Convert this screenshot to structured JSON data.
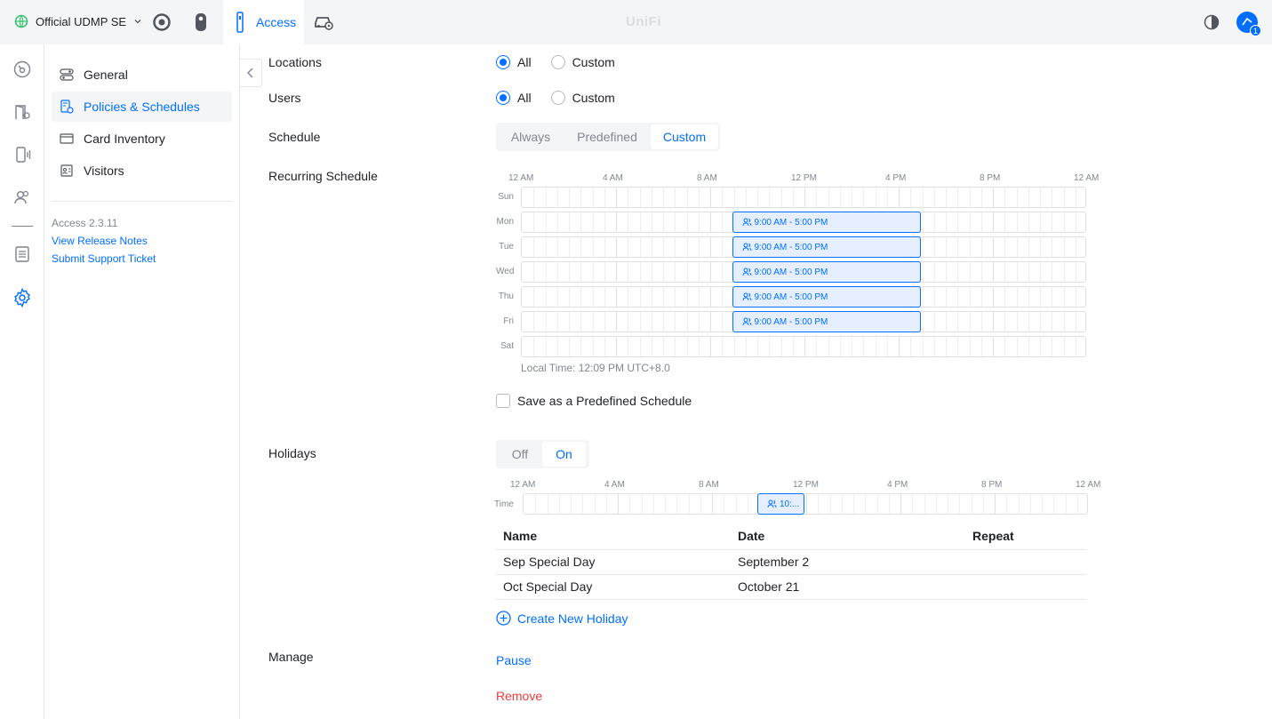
{
  "header": {
    "site_name": "Official UDMP SE",
    "app_tab_label": "Access",
    "brand": "UniFi",
    "notification_count": "1"
  },
  "colors": {
    "accent": "#006fff",
    "danger": "#ee3c3c",
    "block_fill": "#e5efff"
  },
  "sidebar": {
    "items": [
      {
        "label": "General",
        "icon": "toggles-icon"
      },
      {
        "label": "Policies & Schedules",
        "icon": "policy-icon",
        "active": true
      },
      {
        "label": "Card Inventory",
        "icon": "card-icon"
      },
      {
        "label": "Visitors",
        "icon": "visitor-badge-icon"
      }
    ],
    "version": "Access 2.3.11",
    "release_notes": "View Release Notes",
    "support": "Submit Support Ticket"
  },
  "form": {
    "locations": {
      "label": "Locations",
      "all": "All",
      "custom": "Custom",
      "selected": "All"
    },
    "users": {
      "label": "Users",
      "all": "All",
      "custom": "Custom",
      "selected": "All"
    },
    "schedule": {
      "label": "Schedule",
      "options": [
        "Always",
        "Predefined",
        "Custom"
      ],
      "selected": "Custom"
    },
    "recurring": {
      "label": "Recurring Schedule",
      "hour_labels": [
        "12 AM",
        "4 AM",
        "8 AM",
        "12 PM",
        "4 PM",
        "8 PM",
        "12 AM"
      ],
      "days": [
        {
          "day": "Sun",
          "block": null
        },
        {
          "day": "Mon",
          "block": "9:00 AM - 5:00 PM"
        },
        {
          "day": "Tue",
          "block": "9:00 AM - 5:00 PM"
        },
        {
          "day": "Wed",
          "block": "9:00 AM - 5:00 PM"
        },
        {
          "day": "Thu",
          "block": "9:00 AM - 5:00 PM"
        },
        {
          "day": "Fri",
          "block": "9:00 AM - 5:00 PM"
        },
        {
          "day": "Sat",
          "block": null
        }
      ],
      "local_time": "Local Time: 12:09 PM UTC+8.0",
      "save_predefined": "Save as a Predefined Schedule"
    },
    "holidays": {
      "label": "Holidays",
      "options": [
        "Off",
        "On"
      ],
      "selected": "On",
      "time_row_label": "Time",
      "time_block": "10:...",
      "columns": [
        "Name",
        "Date",
        "Repeat"
      ],
      "rows": [
        {
          "name": "Sep Special Day",
          "date": "September 2",
          "repeat": ""
        },
        {
          "name": "Oct Special Day",
          "date": "October 21",
          "repeat": ""
        }
      ],
      "create": "Create New Holiday"
    },
    "manage": {
      "label": "Manage",
      "pause": "Pause",
      "remove": "Remove"
    }
  }
}
